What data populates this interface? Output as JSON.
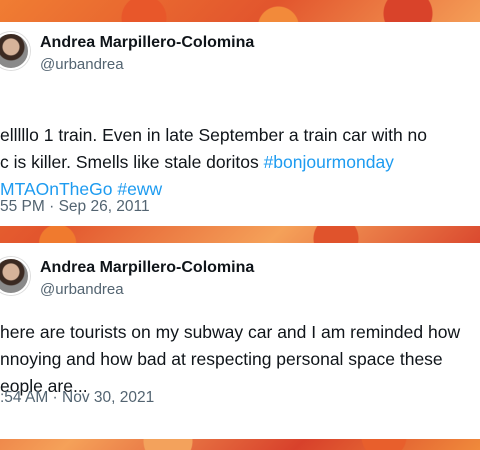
{
  "tweets": [
    {
      "author_name": "Andrea Marpillero-Colomina",
      "handle": "@urbandrea",
      "text_line1": "elllllo 1 train. Even in late September a train car with no",
      "text_line2_plain": "c is killer. Smells like stale doritos ",
      "text_line2_tag": "#bonjourmonday",
      "text_line3_tag1": "MTAOnTheGo",
      "text_line3_tag2": "#eww",
      "timestamp": "55 PM · Sep 26, 2011"
    },
    {
      "author_name": "Andrea Marpillero-Colomina",
      "handle": "@urbandrea",
      "text_line1": "here are tourists on my subway car and I am reminded how",
      "text_line2": "nnoying and how bad at respecting personal space these",
      "text_line3": "eople are...",
      "timestamp": ":54 AM · Nov 30, 2021"
    }
  ],
  "colors": {
    "link": "#1d9bf0",
    "text": "#0f1419",
    "muted": "#536471"
  }
}
